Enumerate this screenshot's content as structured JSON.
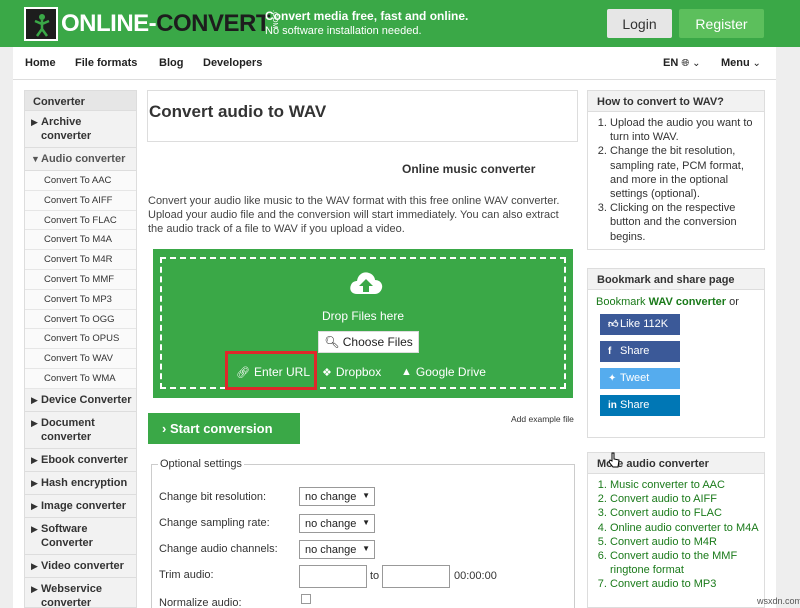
{
  "header": {
    "logo_left": "ONLINE-",
    "logo_right": "CONVERT",
    "logo_com": ".COM",
    "tagline_main": "Convert media free, fast and online.",
    "tagline_sub": "No software installation needed.",
    "login_label": "Login",
    "register_label": "Register",
    "colors": {
      "brand_green": "#3aa847",
      "register_green": "#5cbf5c",
      "highlight_red": "#e0282a"
    }
  },
  "nav": {
    "items": [
      "Home",
      "File formats",
      "Blog",
      "Developers"
    ],
    "language": "EN",
    "menu": "Menu"
  },
  "sidebar": {
    "title": "Converter",
    "before": [
      {
        "label": "Archive converter",
        "arrow": "▶"
      }
    ],
    "active": {
      "label": "Audio converter",
      "arrow": "▼"
    },
    "subitems": [
      "Convert To AAC",
      "Convert To AIFF",
      "Convert To FLAC",
      "Convert To M4A",
      "Convert To M4R",
      "Convert To MMF",
      "Convert To MP3",
      "Convert To OGG",
      "Convert To OPUS",
      "Convert To WAV",
      "Convert To WMA"
    ],
    "after": [
      {
        "label": "Device Converter",
        "arrow": "▶"
      },
      {
        "label": "Document converter",
        "arrow": "▶"
      },
      {
        "label": "Ebook converter",
        "arrow": "▶"
      },
      {
        "label": "Hash encryption",
        "arrow": "▶"
      },
      {
        "label": "Image converter",
        "arrow": "▶"
      },
      {
        "label": "Software Converter",
        "arrow": "▶"
      },
      {
        "label": "Video converter",
        "arrow": "▶"
      },
      {
        "label": "Webservice converter",
        "arrow": "▶"
      }
    ]
  },
  "main": {
    "title": "Convert audio to WAV",
    "subtitle": "Online music converter",
    "description": "Convert your audio like music to the WAV format with this free online WAV converter. Upload your audio file and the conversion will start immediately. You can also extract the audio track of a file to WAV if you upload a video.",
    "upload": {
      "drop_text": "Drop Files here",
      "choose_label": "Choose Files",
      "url_label": "Enter URL",
      "dropbox_label": "Dropbox",
      "gdrive_label": "Google Drive"
    },
    "start_label": "Start conversion",
    "example_link": "Add example file",
    "optional": {
      "legend": "Optional settings",
      "bit_resolution_label": "Change bit resolution:",
      "bit_resolution_value": "no change",
      "sampling_rate_label": "Change sampling rate:",
      "sampling_rate_value": "no change",
      "channels_label": "Change audio channels:",
      "channels_value": "no change",
      "trim_label": "Trim audio:",
      "trim_to": "to",
      "trim_time": "00:00:00",
      "normalize_label": "Normalize audio:"
    }
  },
  "howto": {
    "title": "How to convert to WAV?",
    "steps": [
      "Upload the audio you want to turn into WAV.",
      "Change the bit resolution, sampling rate, PCM format, and more in the optional settings (optional).",
      "Clicking on the respective button and the conversion begins."
    ]
  },
  "bookmark": {
    "title": "Bookmark and share page",
    "text_prefix": "Bookmark ",
    "text_bold": "WAV converter",
    "text_suffix": " or",
    "buttons": [
      {
        "label": "Like 112K",
        "icon": "thumb-up-icon",
        "color": "#3b5998"
      },
      {
        "label": "Share",
        "icon": "facebook-icon",
        "color": "#3b5998"
      },
      {
        "label": "Tweet",
        "icon": "twitter-icon",
        "color": "#55acee"
      },
      {
        "label": "Share",
        "icon": "linkedin-icon",
        "color": "#0077b5"
      }
    ]
  },
  "more": {
    "title": "More audio converter",
    "links": [
      "Music converter to AAC",
      "Convert audio to AIFF",
      "Convert audio to FLAC",
      "Online audio converter to M4A",
      "Convert audio to M4R",
      "Convert audio to the MMF ringtone format",
      "Convert audio to MP3"
    ]
  },
  "watermark": "wsxdn.com"
}
